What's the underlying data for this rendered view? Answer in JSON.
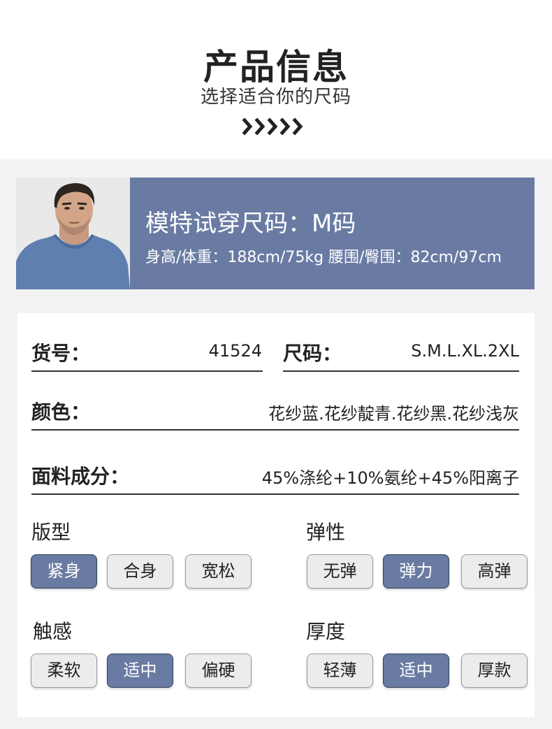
{
  "header": {
    "title": "产品信息",
    "subtitle": "选择适合你的尺码",
    "decoration": "chevron-right-icons"
  },
  "model": {
    "size_line": "模特试穿尺码：M码",
    "measure_line": "身高/体重：188cm/75kg  腰围/臀围：82cm/97cm",
    "band_color": "#6a7ba3"
  },
  "specs": {
    "item_no": {
      "label": "货号：",
      "value": "41524"
    },
    "size": {
      "label": "尺码：",
      "value": "S.M.L.XL.2XL"
    },
    "color": {
      "label": "颜色：",
      "value": "花纱蓝.花纱靛青.花纱黑.花纱浅灰"
    },
    "fabric": {
      "label": "面料成分：",
      "value": "45%涤纶+10%氨纶+45%阳离子"
    }
  },
  "attributes": {
    "fit": {
      "title": "版型",
      "options": [
        "紧身",
        "合身",
        "宽松"
      ],
      "selected": "紧身"
    },
    "elasticity": {
      "title": "弹性",
      "options": [
        "无弹",
        "弹力",
        "高弹"
      ],
      "selected": "弹力"
    },
    "touch": {
      "title": "触感",
      "options": [
        "柔软",
        "适中",
        "偏硬"
      ],
      "selected": "适中"
    },
    "thickness": {
      "title": "厚度",
      "options": [
        "轻薄",
        "适中",
        "厚款"
      ],
      "selected": "适中"
    }
  },
  "colors": {
    "accent": "#6a7ba3",
    "chip_inactive": "#ececec",
    "text": "#222222"
  }
}
